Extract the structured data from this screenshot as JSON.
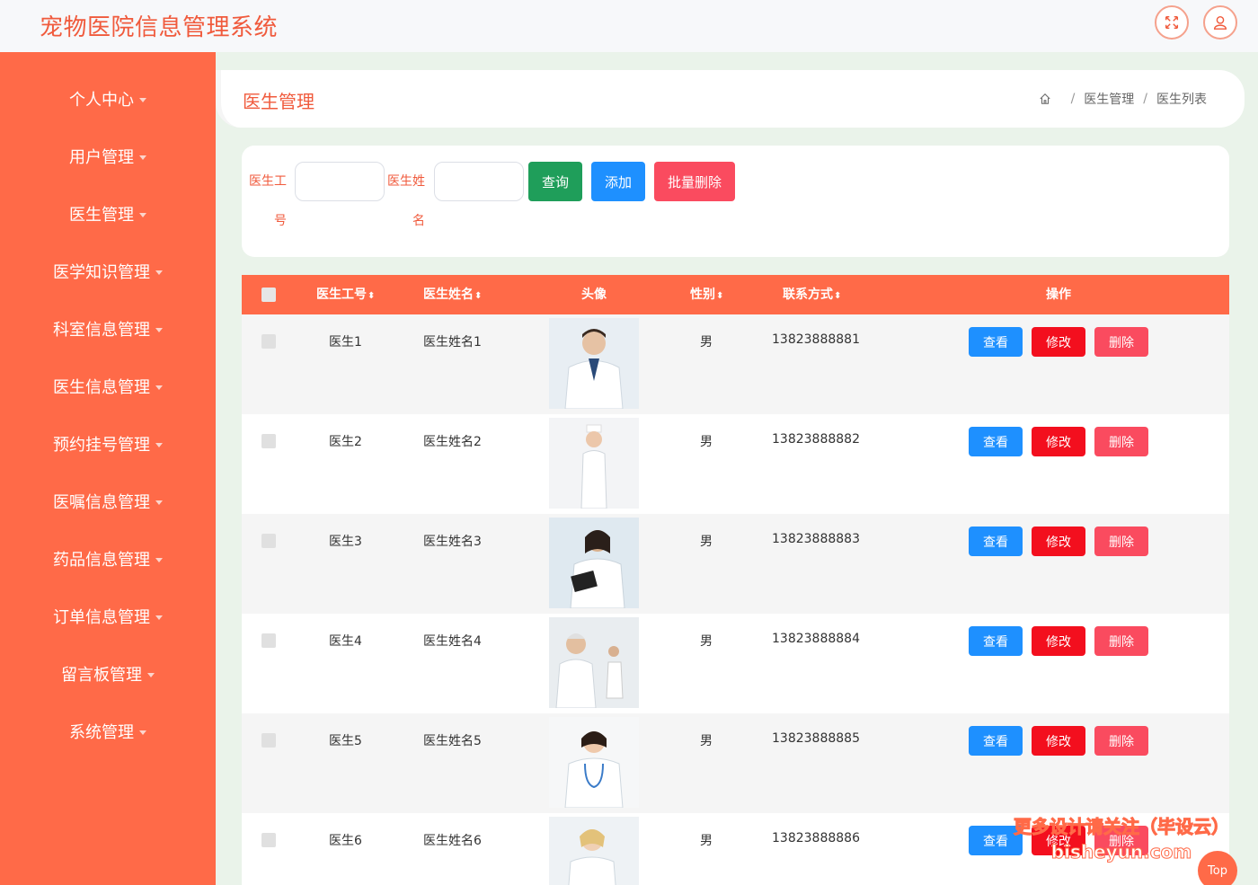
{
  "header": {
    "app_title": "宠物医院信息管理系统"
  },
  "sidebar": {
    "items": [
      {
        "label": "个人中心"
      },
      {
        "label": "用户管理"
      },
      {
        "label": "医生管理"
      },
      {
        "label": "医学知识管理"
      },
      {
        "label": "科室信息管理"
      },
      {
        "label": "医生信息管理"
      },
      {
        "label": "预约挂号管理"
      },
      {
        "label": "医嘱信息管理"
      },
      {
        "label": "药品信息管理"
      },
      {
        "label": "订单信息管理"
      },
      {
        "label": "留言板管理"
      },
      {
        "label": "系统管理"
      }
    ]
  },
  "page": {
    "title": "医生管理",
    "breadcrumb": [
      "医生管理",
      "医生列表"
    ],
    "breadcrumb_sep": "/"
  },
  "search": {
    "label_id_1": "医生工",
    "label_id_2": "号",
    "label_name_1": "医生姓",
    "label_name_2": "名",
    "query_button": "查询",
    "add_button": "添加",
    "batch_delete_button": "批量删除"
  },
  "table": {
    "columns": [
      "医生工号",
      "医生姓名",
      "头像",
      "性别",
      "联系方式",
      "操作"
    ],
    "sort_glyph": "⬍",
    "actions": {
      "view": "查看",
      "edit": "修改",
      "delete": "删除"
    },
    "rows": [
      {
        "id": "医生1",
        "name": "医生姓名1",
        "gender": "男",
        "phone": "13823888881"
      },
      {
        "id": "医生2",
        "name": "医生姓名2",
        "gender": "男",
        "phone": "13823888882"
      },
      {
        "id": "医生3",
        "name": "医生姓名3",
        "gender": "男",
        "phone": "13823888883"
      },
      {
        "id": "医生4",
        "name": "医生姓名4",
        "gender": "男",
        "phone": "13823888884"
      },
      {
        "id": "医生5",
        "name": "医生姓名5",
        "gender": "男",
        "phone": "13823888885"
      },
      {
        "id": "医生6",
        "name": "医生姓名6",
        "gender": "男",
        "phone": "13823888886"
      }
    ]
  },
  "watermark": {
    "line1": "更多设计请关注（毕设云）",
    "line2": "bisheyun.com"
  },
  "back_to_top": "Top",
  "colors": {
    "accent": "#ff6a48",
    "query": "#1f9e5a",
    "add": "#1e90ff",
    "edit": "#f30f1e",
    "delete": "#fa4b5f"
  }
}
